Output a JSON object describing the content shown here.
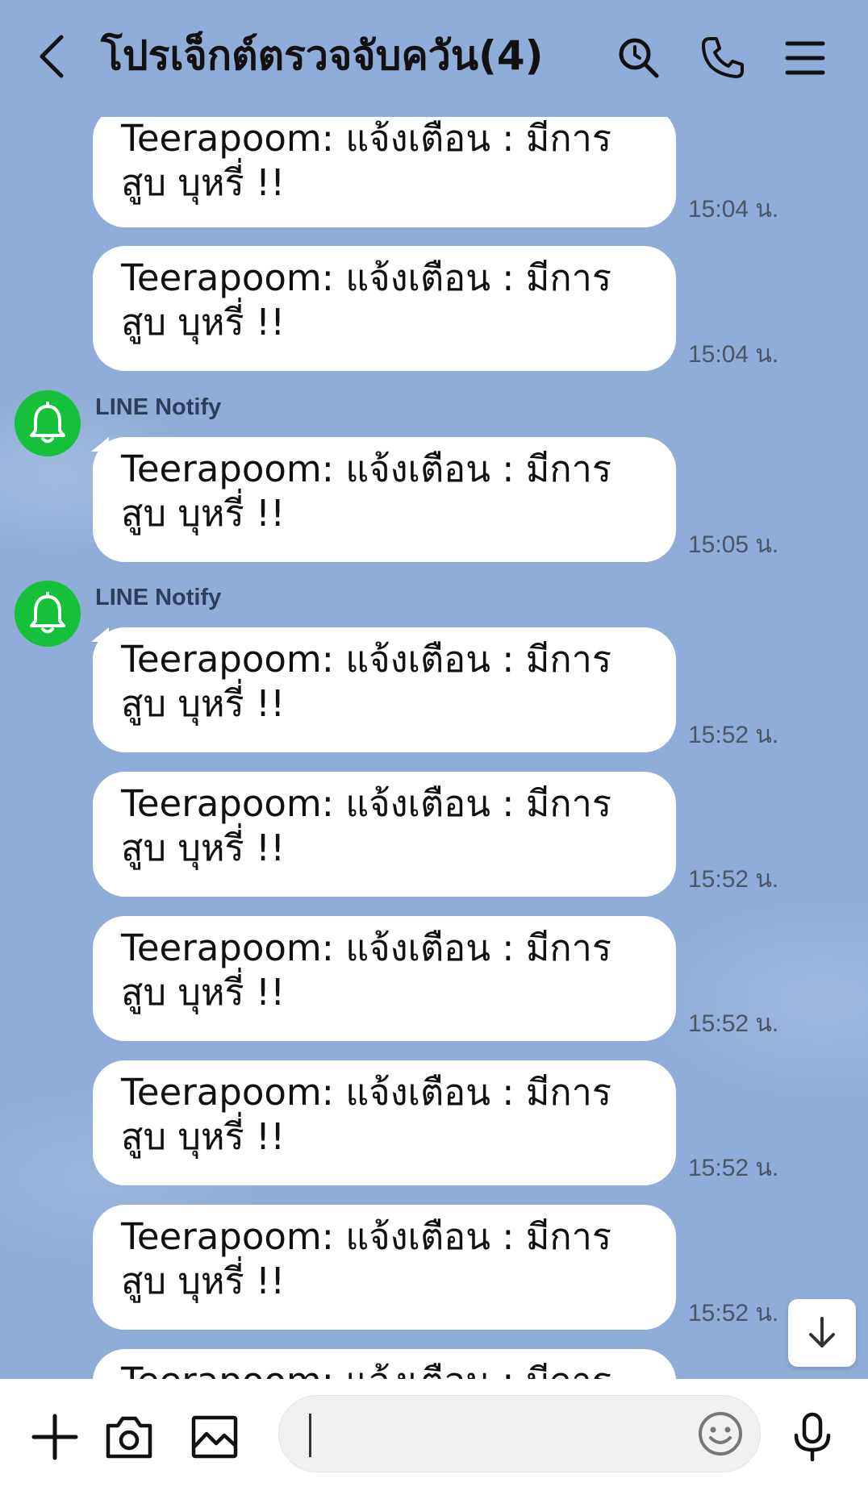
{
  "header": {
    "title": "โปรเจ็กต์ตรวจจับควัน(4)",
    "icons": [
      "back-icon",
      "search-icon",
      "phone-icon",
      "menu-icon"
    ]
  },
  "chat": {
    "sender_name": "LINE Notify",
    "messages": [
      {
        "text": "Teerapoom: แจ้งเตือน : มีการสูบ บุหรี่ !!",
        "time": "15:04 น."
      },
      {
        "text": "Teerapoom: แจ้งเตือน : มีการสูบ บุหรี่ !!",
        "time": "15:04 น."
      },
      {
        "text": "Teerapoom: แจ้งเตือน : มีการสูบ บุหรี่ !!",
        "time": "15:05 น."
      },
      {
        "text": "Teerapoom: แจ้งเตือน : มีการสูบ บุหรี่ !!",
        "time": "15:52 น."
      },
      {
        "text": "Teerapoom: แจ้งเตือน : มีการสูบ บุหรี่ !!",
        "time": "15:52 น."
      },
      {
        "text": "Teerapoom: แจ้งเตือน : มีการสูบ บุหรี่ !!",
        "time": "15:52 น."
      },
      {
        "text": "Teerapoom: แจ้งเตือน : มีการสูบ บุหรี่ !!",
        "time": "15:52 น."
      },
      {
        "text": "Teerapoom: แจ้งเตือน : มีการสูบ บุหรี่ !!",
        "time": "15:52 น."
      },
      {
        "text": "Teerapoom: แจ้งเตือน : มีการสูบ",
        "time": ""
      }
    ]
  },
  "footer": {
    "icons": [
      "plus-icon",
      "camera-icon",
      "image-icon",
      "emoji-icon",
      "microphone-icon"
    ],
    "input_value": ""
  },
  "colors": {
    "background": "#8fadd8",
    "bubble": "#ffffff",
    "avatar": "#15c03a"
  }
}
